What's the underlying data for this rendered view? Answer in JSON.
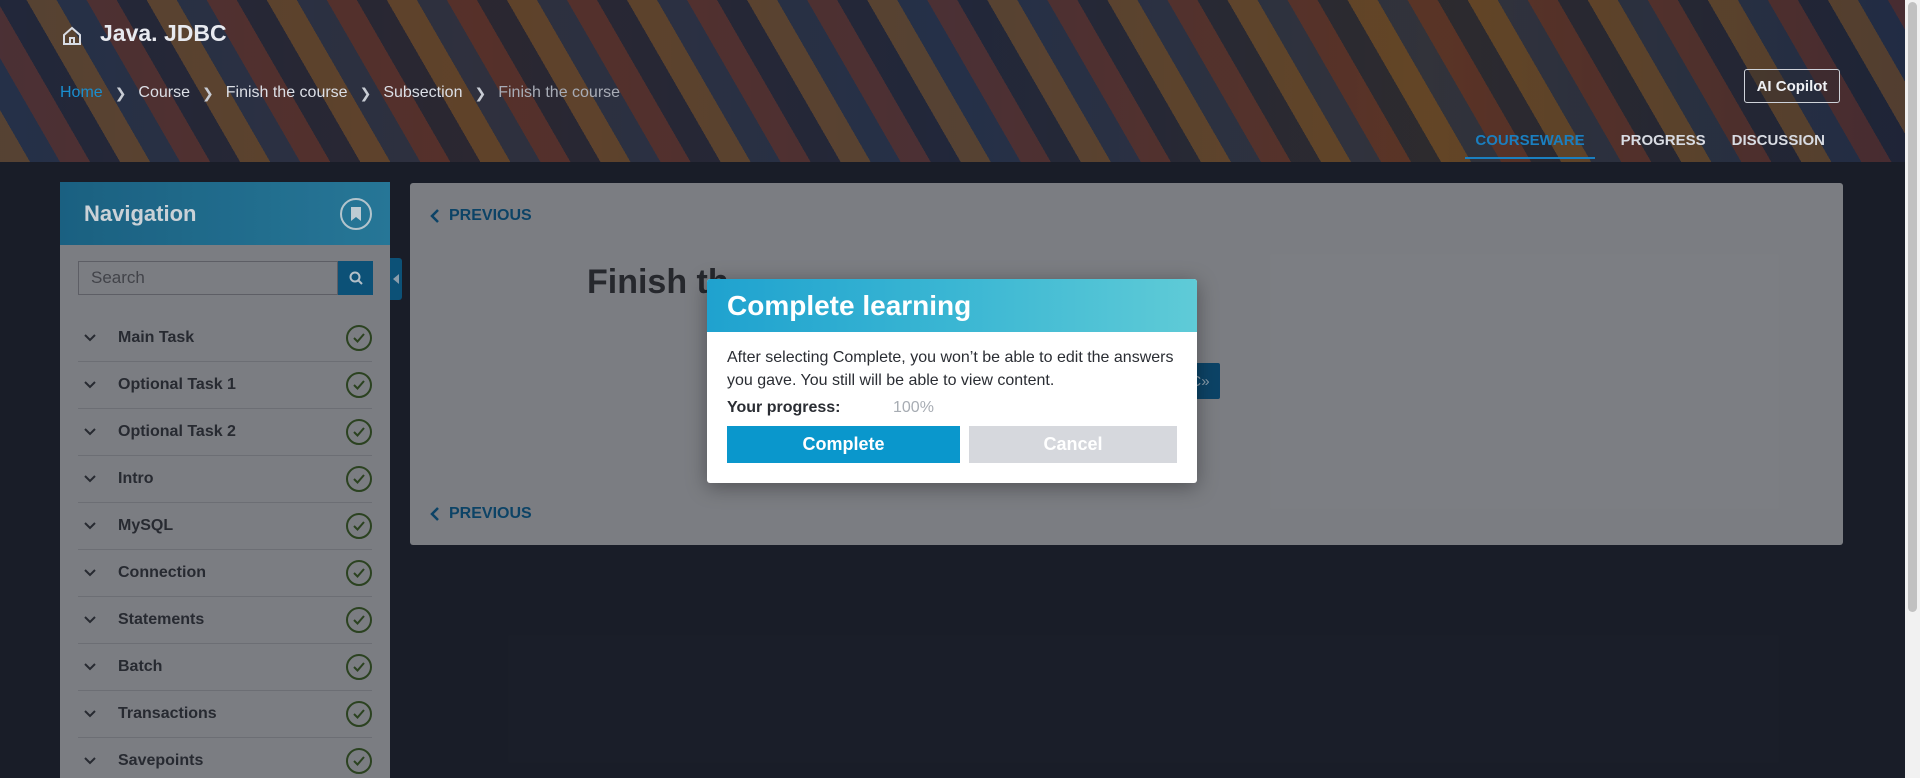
{
  "header": {
    "course_title": "Java. JDBC",
    "breadcrumb": [
      {
        "label": "Home"
      },
      {
        "label": "Course"
      },
      {
        "label": "Finish the course"
      },
      {
        "label": "Subsection"
      },
      {
        "label": "Finish the course"
      }
    ],
    "copilot_label": "AI Copilot",
    "tabs": [
      {
        "label": "COURSEWARE",
        "active": true
      },
      {
        "label": "PROGRESS",
        "active": false
      },
      {
        "label": "DISCUSSION",
        "active": false
      }
    ]
  },
  "sidebar": {
    "title": "Navigation",
    "search_placeholder": "Search",
    "items": [
      {
        "label": "Main Task",
        "completed": true
      },
      {
        "label": "Optional Task 1",
        "completed": true
      },
      {
        "label": "Optional Task 2",
        "completed": true
      },
      {
        "label": "Intro",
        "completed": true
      },
      {
        "label": "MySQL",
        "completed": true
      },
      {
        "label": "Connection",
        "completed": true
      },
      {
        "label": "Statements",
        "completed": true
      },
      {
        "label": "Batch",
        "completed": true
      },
      {
        "label": "Transactions",
        "completed": true
      },
      {
        "label": "Savepoints",
        "completed": true
      }
    ]
  },
  "content": {
    "previous_label": "PREVIOUS",
    "unit_title": "Finish th",
    "partial_button": "C»"
  },
  "modal": {
    "title": "Complete learning",
    "text": "After selecting Complete, you won’t be able to edit the answers you gave. You still will be able to view content.",
    "progress_label": "Your progress:",
    "progress_value": "100%",
    "complete_label": "Complete",
    "cancel_label": "Cancel"
  },
  "colors": {
    "accent": "#0a97cc",
    "nav_header": "#1c6e93",
    "completed_check": "#2f4a22"
  }
}
